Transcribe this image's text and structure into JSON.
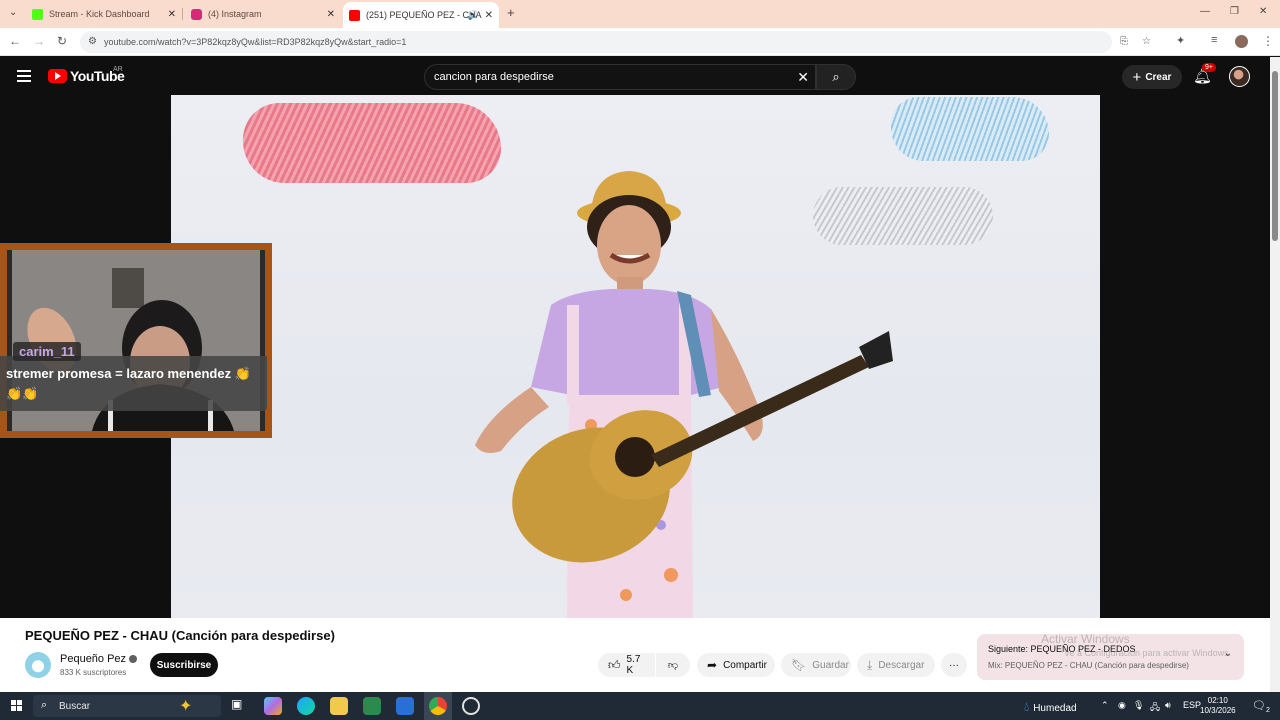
{
  "browser": {
    "tabs": [
      {
        "title": "Stream - Kick Dashboard",
        "favicon_color": "#53fc18"
      },
      {
        "title": "(4) Instagram",
        "favicon_color": "#d62976"
      },
      {
        "title": "(251) PEQUEÑO PEZ - CHA",
        "favicon_color": "#ff0000",
        "active": true
      }
    ],
    "new_tab_label": "+",
    "url": "youtube.com/watch?v=3P82kqz8yQw&list=RD3P82kqz8yQw&start_radio=1"
  },
  "youtube": {
    "logo_text": "YouTube",
    "country_code": "AR",
    "search_value": "cancion para despedirse",
    "create_label": "Crear",
    "notification_badge": "9+"
  },
  "stream_overlay": {
    "chat_username": "carim_11",
    "chat_message": "stremer promesa = lazaro menendez 👏👏👏"
  },
  "video": {
    "title": "PEQUEÑO PEZ - CHAU (Canción para despedirse)",
    "channel_name": "Pequeño Pez",
    "subscribers": "833 K suscriptores",
    "subscribe_label": "Suscribirse",
    "likes": "5.7 K",
    "share_label": "Compartir",
    "save_label": "Guardar",
    "download_label": "Descargar",
    "more_label": "···"
  },
  "up_next": {
    "line1": "Siguiente: PEQUEÑO PEZ - DEDOS",
    "line2": "Mix: PEQUEÑO PEZ - CHAU (Canción para despedirse)"
  },
  "watermark": {
    "line1": "Activar Windows",
    "line2": "Ve a Configuración para activar Windows."
  },
  "taskbar": {
    "search_label": "Buscar",
    "weather": "Humedad",
    "language": "ESP",
    "time": "02:10",
    "date": "10/3/2026",
    "notif_count": "2"
  }
}
